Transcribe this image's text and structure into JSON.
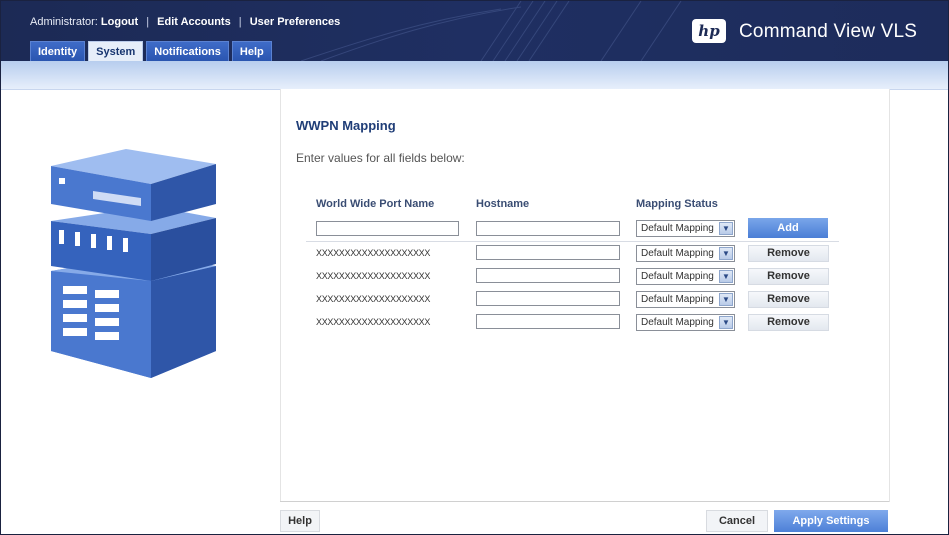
{
  "header": {
    "admin_label": "Administrator:",
    "links": {
      "logout": "Logout",
      "edit_accounts": "Edit Accounts",
      "user_preferences": "User Preferences"
    },
    "separator": "|",
    "tabs": [
      {
        "label": "Identity"
      },
      {
        "label": "System"
      },
      {
        "label": "Notifications"
      },
      {
        "label": "Help"
      }
    ],
    "active_tab": "System",
    "logo_text": "hp",
    "product_name": "Command View VLS"
  },
  "main": {
    "title": "WWPN Mapping",
    "instructions": "Enter values for all fields below:",
    "columns": {
      "wwpn": "World Wide Port Name",
      "hostname": "Hostname",
      "mapping_status": "Mapping Status"
    },
    "new_entry": {
      "wwpn_value": "",
      "hostname_value": "",
      "mapping_status": "Default Mapping",
      "add_label": "Add"
    },
    "rows": [
      {
        "wwpn": "XXXXXXXXXXXXXXXXXXXX",
        "hostname": "",
        "mapping_status": "Default Mapping",
        "action": "Remove"
      },
      {
        "wwpn": "XXXXXXXXXXXXXXXXXXXX",
        "hostname": "",
        "mapping_status": "Default Mapping",
        "action": "Remove"
      },
      {
        "wwpn": "XXXXXXXXXXXXXXXXXXXX",
        "hostname": "",
        "mapping_status": "Default Mapping",
        "action": "Remove"
      },
      {
        "wwpn": "XXXXXXXXXXXXXXXXXXXX",
        "hostname": "",
        "mapping_status": "Default Mapping",
        "action": "Remove"
      }
    ]
  },
  "footer": {
    "help_label": "Help",
    "cancel_label": "Cancel",
    "apply_label": "Apply Settings"
  },
  "colors": {
    "header_bg": "#1c2a55",
    "tab_bg": "#2f5cb8",
    "accent_button": "#5a8cdf",
    "title_text": "#1f3d77"
  },
  "icons": {
    "illustration": "storage-array-icon",
    "dropdown": "chevron-down-icon"
  }
}
